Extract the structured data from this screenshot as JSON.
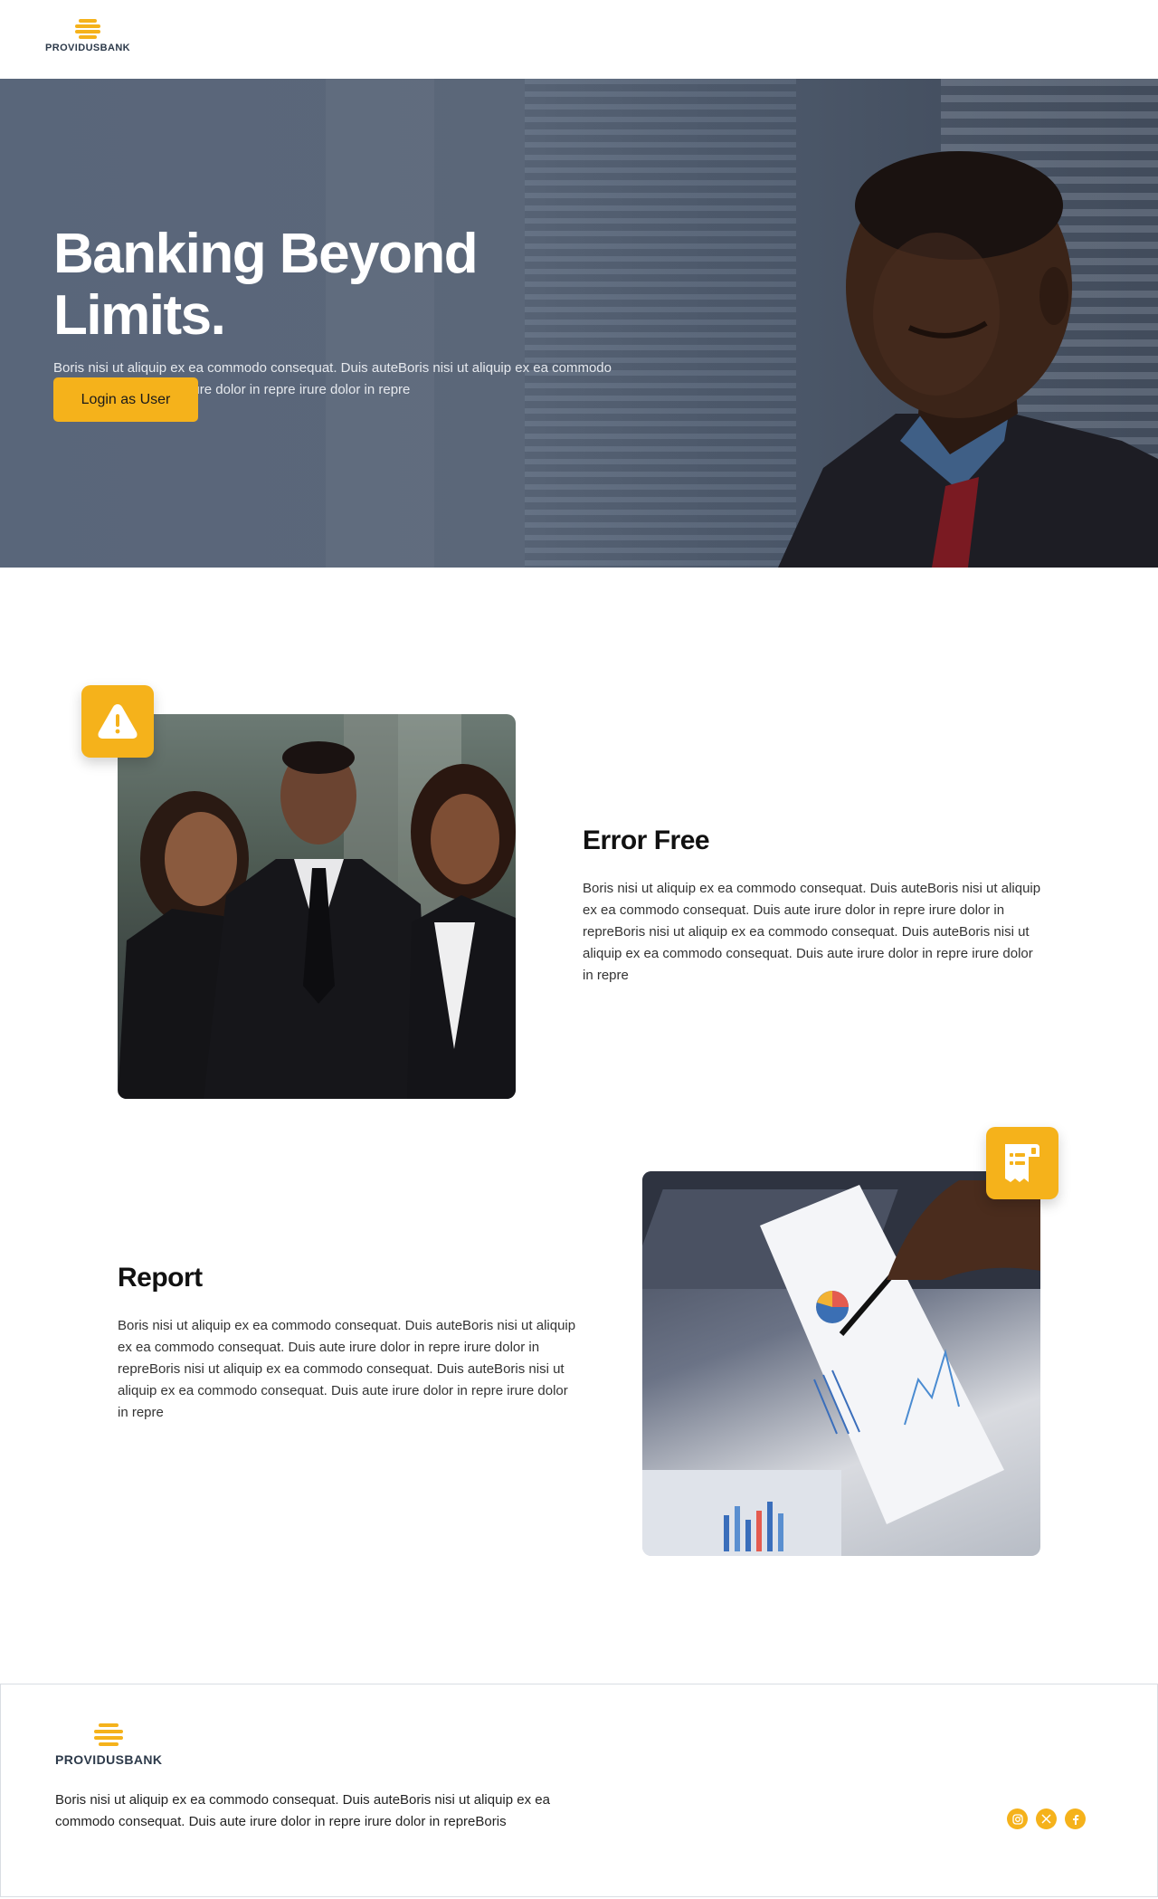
{
  "brand": {
    "name": "PROVIDUSBANK",
    "accent_color": "#f5b21b",
    "logo_icon": "providus-logo-icon"
  },
  "hero": {
    "title": "Banking Beyond Limits.",
    "subtitle": "Boris nisi ut aliquip ex ea commodo consequat. Duis auteBoris nisi ut aliquip ex ea commodo consequat. Duis aute irure dolor in repre irure dolor in repre",
    "cta_label": "Login as User",
    "background_image": "businessman-portrait-photo"
  },
  "features": [
    {
      "title": "Error Free",
      "body": "Boris nisi ut aliquip ex ea commodo consequat. Duis auteBoris nisi ut aliquip ex ea commodo consequat. Duis aute irure dolor in repre irure dolor in repreBoris nisi ut aliquip ex ea commodo consequat. Duis auteBoris nisi ut aliquip ex ea commodo consequat. Duis aute irure dolor in repre irure dolor in repre",
      "icon": "warning-icon",
      "image": "business-team-photo"
    },
    {
      "title": "Report",
      "body": "Boris nisi ut aliquip ex ea commodo consequat. Duis auteBoris nisi ut aliquip ex ea commodo consequat. Duis aute irure dolor in repre irure dolor in repreBoris nisi ut aliquip ex ea commodo consequat. Duis auteBoris nisi ut aliquip ex ea commodo consequat. Duis aute irure dolor in repre irure dolor in repre",
      "icon": "receipt-icon",
      "image": "finance-report-photo"
    }
  ],
  "footer": {
    "brand_name": "PROVIDUSBANK",
    "body": "Boris nisi ut aliquip ex ea commodo consequat. Duis auteBoris nisi ut aliquip ex ea commodo consequat. Duis aute irure dolor in repre irure dolor in repreBoris",
    "socials": [
      "instagram-icon",
      "x-icon",
      "facebook-icon"
    ]
  }
}
